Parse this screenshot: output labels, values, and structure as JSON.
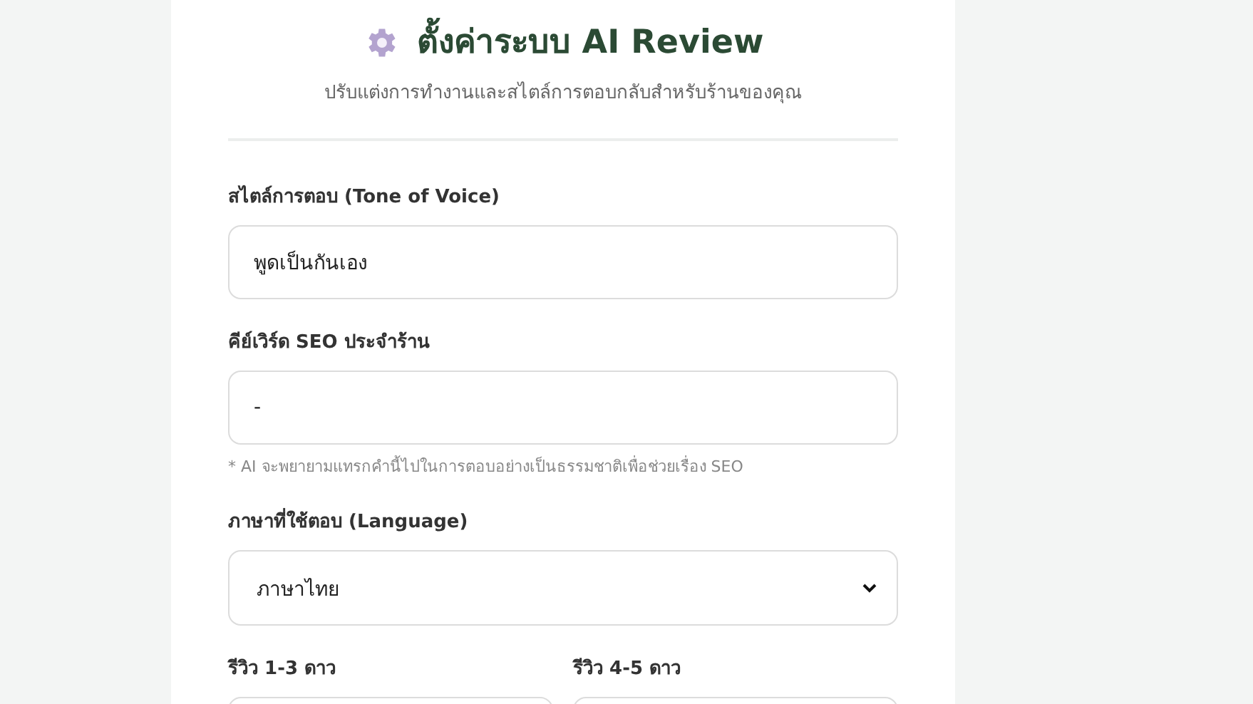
{
  "header": {
    "title": "ตั้งค่าระบบ AI Review",
    "subtitle": "ปรับแต่งการทำงานและสไตล์การตอบกลับสำหรับร้านของคุณ"
  },
  "fields": [
    {
      "kind": "text",
      "label": "สไตล์การตอบ (Tone of Voice)",
      "value": "พูดเป็นกันเอง"
    },
    {
      "kind": "text",
      "label": "คีย์เวิร์ด SEO ประจำร้าน",
      "value": "-",
      "hint": "* AI จะพยายามแทรกคำนี้ไปในการตอบอย่างเป็นธรรมชาติเพื่อช่วยเรื่อง SEO"
    },
    {
      "kind": "select",
      "label": "ภาษาที่ใช้ตอบ (Language)",
      "value": "ภาษาไทย"
    }
  ],
  "review_fields": [
    {
      "label": "รีวิว 1-3 ดาว"
    },
    {
      "label": "รีวิว 4-5 ดาว"
    }
  ]
}
